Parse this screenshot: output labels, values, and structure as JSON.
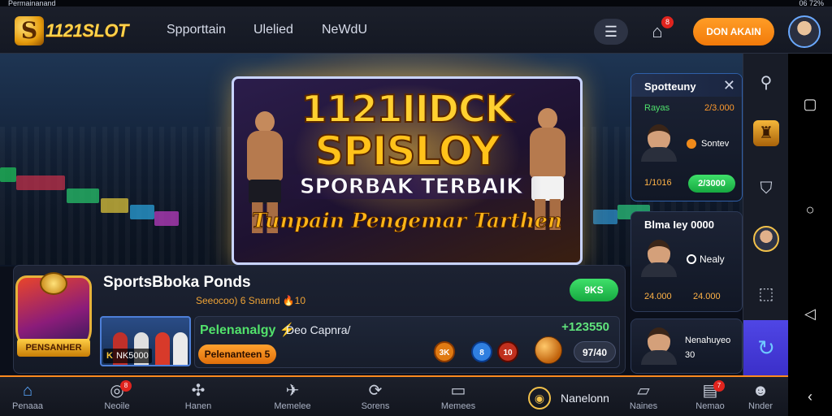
{
  "status_bar": {
    "left_text": "Permainanand",
    "right_text": "06 72%"
  },
  "header": {
    "logo_letter": "S",
    "logo_text": "1121SLOT",
    "nav": [
      "Spporttain",
      "Ulelied",
      "NeWdU"
    ],
    "menu_icon": "list-icon",
    "notification_icon": "bell-icon",
    "notification_count": "8",
    "login_label": "DON AKAIN",
    "avatar": "user-avatar"
  },
  "hero": {
    "title_line1": "1121IIDCK",
    "title_line2": "SPISLOY",
    "title_line3": "SPORBAK TERBAIK",
    "title_line4": "Tunpain Pengemar Tarthen"
  },
  "strip": {
    "title": "SportsBboka Ponds",
    "subtitle": "Seeocoo) 6 Snarnd 🔥10",
    "top_button": "9KS",
    "emblem_label": "PENSANHER",
    "thumb_tag_left": "K",
    "thumb_tag_value": "NK5000",
    "panel": {
      "label_green": "Pelenanalgy ⚡",
      "label_white": "Deo Capnra/",
      "odds": "+123550",
      "action_button": "Pelenanteen 5",
      "chips": [
        "3K",
        "8",
        "10"
      ],
      "result_pill": "97/40"
    }
  },
  "cards": [
    {
      "header": "Spotteuny",
      "row1_left": "Rayas",
      "row1_right": "2/3.000",
      "player_label": "Sontev",
      "bottom_left": "1/1016",
      "bottom_pill": "2/3000"
    },
    {
      "header": "Blma Iey 0000",
      "player_label": "Nealy",
      "bottom_left": "24.000",
      "bottom_right": "24.000"
    },
    {
      "header": "Nenahuyeo",
      "player_label": "30"
    }
  ],
  "rail_icons": [
    "hook-icon",
    "trophy-shield-icon",
    "shield-check-icon",
    "player-avatar",
    "box-icon",
    "refresh-icon"
  ],
  "bottom_nav": [
    {
      "label": "Penaaa",
      "icon": "home-icon"
    },
    {
      "label": "Neoile",
      "icon": "target-icon",
      "badge": "8"
    },
    {
      "label": "Hanen",
      "icon": "puzzle-icon"
    },
    {
      "label": "Memelee",
      "icon": "bird-icon"
    },
    {
      "label": "Sorens",
      "icon": "sync-icon"
    },
    {
      "label": "Memees",
      "icon": "chat-icon"
    },
    {
      "label": "Nanelonn",
      "icon": "coin-icon"
    },
    {
      "label": "Naines",
      "icon": "message-icon"
    },
    {
      "label": "Nemao",
      "icon": "ticket-icon",
      "badge": "7"
    },
    {
      "label": "Nnder",
      "icon": "face-icon"
    }
  ],
  "android_nav": [
    "square-icon",
    "circle-icon",
    "back-triangle-icon",
    "back-arrow-icon"
  ],
  "colors": {
    "accent": "#ff8a1e",
    "brand_gold": "#ffd24a",
    "green": "#3fe06a",
    "active": "#4f46e5"
  }
}
